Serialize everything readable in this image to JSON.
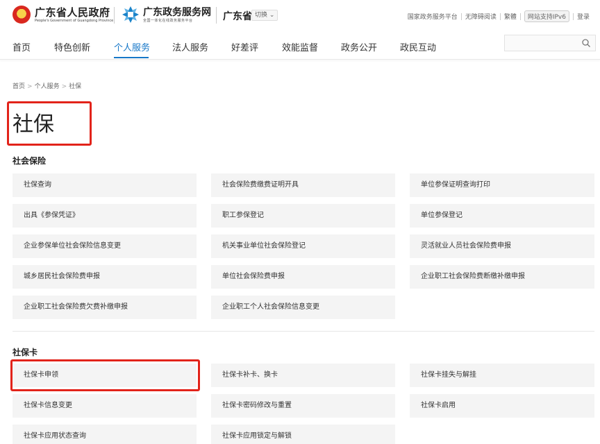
{
  "header": {
    "gov_title": "广东省人民政府",
    "gov_subtitle": "People's Government of Guangdong Province",
    "service_title": "广东政务服务网",
    "service_subtitle": "全国一体化在线政务服务平台",
    "province": "广东省",
    "switch_label": "切换 ⌄",
    "links": [
      "国家政务服务平台",
      "无障碍阅读",
      "繁體",
      "网站支持IPv6",
      "登录"
    ],
    "colors": {
      "emblem_red": "#d9281f",
      "logo_blue": "#1b83c9"
    }
  },
  "nav": {
    "items": [
      "首页",
      "特色创新",
      "个人服务",
      "法人服务",
      "好差评",
      "效能监督",
      "政务公开",
      "政民互动"
    ],
    "active_index": 2,
    "search_placeholder": "",
    "accent": "#1677c8"
  },
  "breadcrumb": [
    "首页",
    "个人服务",
    "社保"
  ],
  "page_title": "社保",
  "highlight_color": "#e2231a",
  "sections": [
    {
      "title": "社会保险",
      "items": [
        "社保查询",
        "社会保险费缴费证明开具",
        "单位参保证明查询打印",
        "出具《参保凭证》",
        "职工参保登记",
        "单位参保登记",
        "企业参保单位社会保险信息变更",
        "机关事业单位社会保险登记",
        "灵活就业人员社会保险费申报",
        "城乡居民社会保险费申报",
        "单位社会保险费申报",
        "企业职工社会保险费断缴补缴申报",
        "企业职工社会保险费欠费补缴申报",
        "企业职工个人社会保险信息变更"
      ]
    },
    {
      "title": "社保卡",
      "items": [
        "社保卡申领",
        "社保卡补卡、换卡",
        "社保卡挂失与解挂",
        "社保卡信息变更",
        "社保卡密码修改与重置",
        "社保卡启用",
        "社保卡应用状态查询",
        "社保卡应用锁定与解锁"
      ]
    }
  ]
}
